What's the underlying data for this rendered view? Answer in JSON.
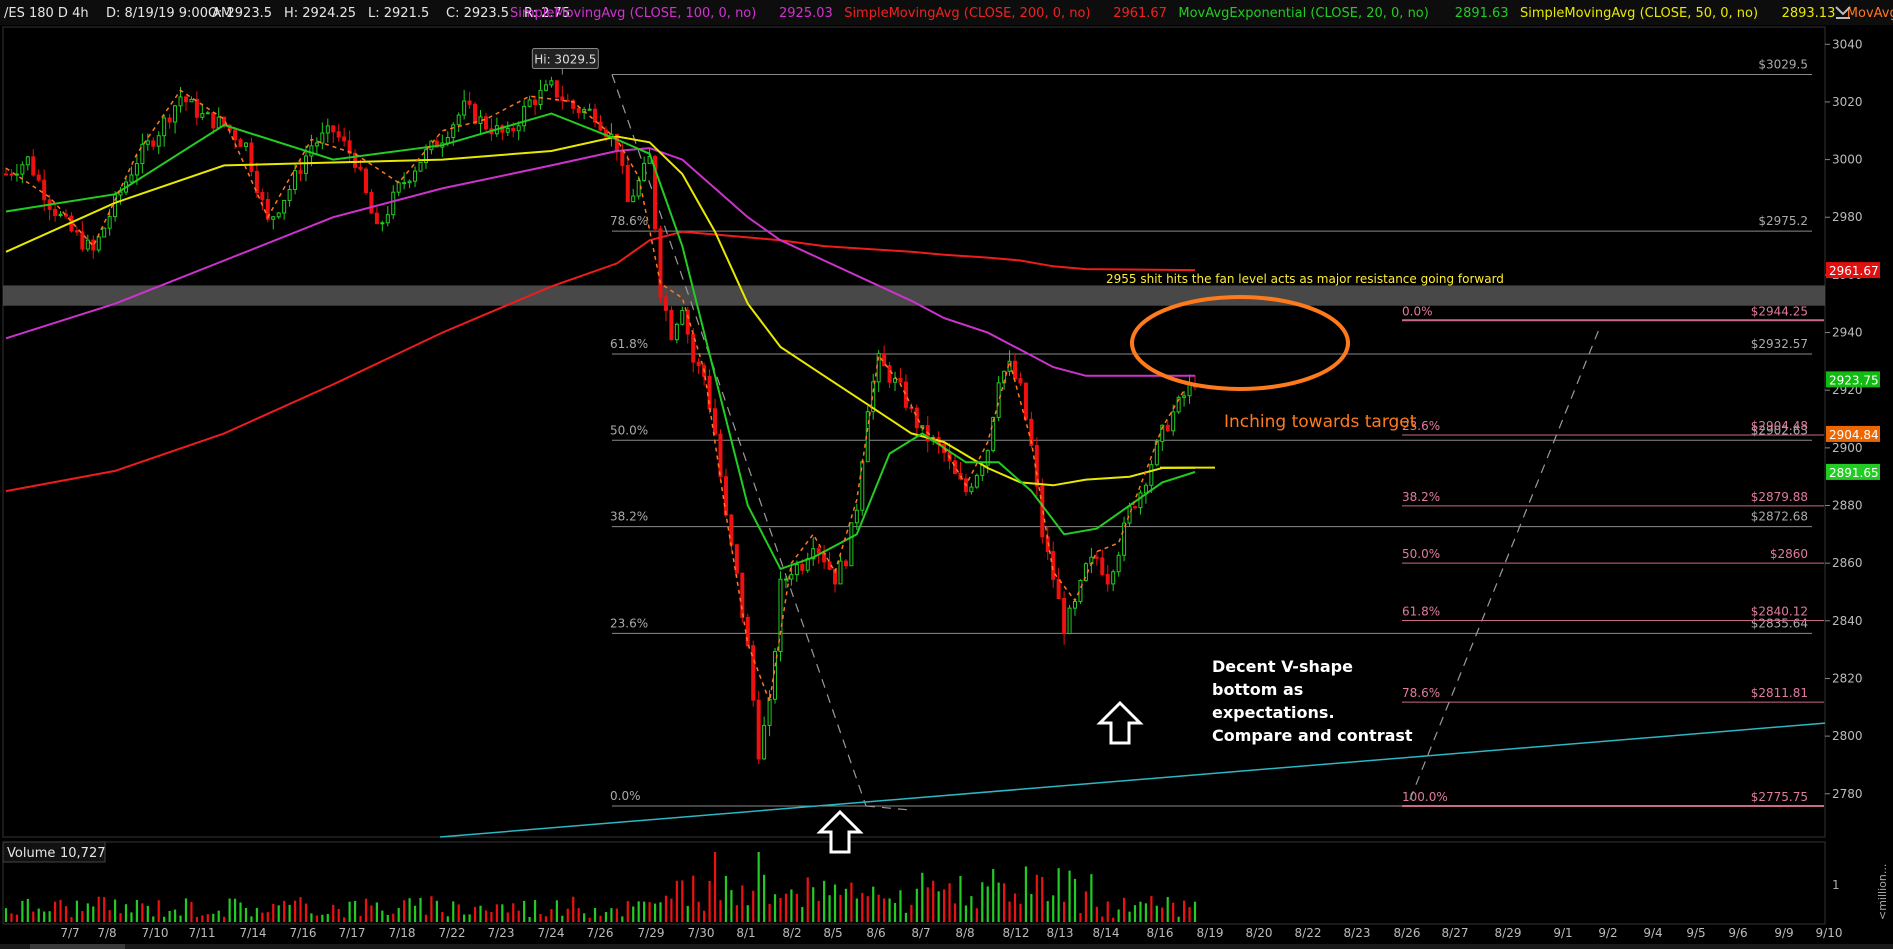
{
  "header": {
    "symbol": "/ES 180 D 4h",
    "date": "D: 8/19/19 9:00 AM",
    "open": "O: 2923.5",
    "high": "H: 2924.25",
    "low": "L: 2921.5",
    "close": "C: 2923.5",
    "range": "R: 2.75",
    "studies": [
      {
        "label": "SimpleMovingAvg (CLOSE, 100, 0, no)",
        "value": "2925.03",
        "color": "#d033d0"
      },
      {
        "label": "SimpleMovingAvg (CLOSE, 200, 0, no)",
        "value": "2961.67",
        "color": "#ee2222"
      },
      {
        "label": "MovAvgExponential (CLOSE, 20, 0, no)",
        "value": "2891.63",
        "color": "#22cc22"
      },
      {
        "label": "SimpleMovingAvg (CLOSE, 50, 0, no)",
        "value": "2893.13",
        "color": "#e8e800"
      },
      {
        "label": "MovAvgExponential (CLOSE,...",
        "value": "",
        "color": "#ff7722"
      }
    ]
  },
  "price_axis": {
    "ticks": [
      "3040",
      "3020",
      "3000",
      "2980",
      "2960",
      "2940",
      "2920",
      "2900",
      "2880",
      "2860",
      "2840",
      "2820",
      "2800",
      "2780"
    ],
    "badges": [
      {
        "text": "2961.67",
        "value": 2961.67,
        "bg": "#e01010"
      },
      {
        "text": "2923.75",
        "value": 2923.75,
        "bg": "#11bb11"
      },
      {
        "text": "2904.84",
        "value": 2904.84,
        "bg": "#ee6600"
      },
      {
        "text": "2891.65",
        "value": 2891.65,
        "bg": "#22cc22"
      }
    ]
  },
  "hi_label": "Hi: 3029.5",
  "fib_left": [
    {
      "pct": "78.6%",
      "value": 2975.2,
      "price": "$2975.2"
    },
    {
      "pct": "61.8%",
      "value": 2932.57,
      "price": "$2932.57"
    },
    {
      "pct": "50.0%",
      "value": 2902.63,
      "price": "$2902.63"
    },
    {
      "pct": "38.2%",
      "value": 2872.68,
      "price": "$2872.68"
    },
    {
      "pct": "23.6%",
      "value": 2835.64,
      "price": "$2835.64"
    },
    {
      "pct": "0.0%",
      "value": 2775.75,
      "price": ""
    }
  ],
  "fib_top_price": {
    "value": 3029.5,
    "price": "$3029.5"
  },
  "fib_right": [
    {
      "pct": "0.0%",
      "value": 2944.25,
      "price": "$2944.25"
    },
    {
      "pct": "23.6%",
      "value": 2904.48,
      "price": "$2904.48"
    },
    {
      "pct": "38.2%",
      "value": 2879.88,
      "price": "$2879.88"
    },
    {
      "pct": "50.0%",
      "value": 2860.0,
      "price": "$2860"
    },
    {
      "pct": "61.8%",
      "value": 2840.12,
      "price": "$2840.12"
    },
    {
      "pct": "78.6%",
      "value": 2811.81,
      "price": "$2811.81"
    },
    {
      "pct": "100.0%",
      "value": 2775.75,
      "price": "$2775.75"
    }
  ],
  "resistance_zone": [
    2950,
    2956
  ],
  "annotations": {
    "resistance_note": "2955 shit hits the fan level acts as  major resistance going forward",
    "target_note": "Inching towards target",
    "vshape_note": [
      "Decent V-shape",
      "bottom as",
      "expectations.",
      "Compare and contrast"
    ]
  },
  "volume": {
    "label": "Volume",
    "value": "10,727",
    "axis_tick": "1",
    "axis_unit": "<million..."
  },
  "x_axis": [
    "7/7",
    "7/8",
    "7/10",
    "7/11",
    "7/14",
    "7/16",
    "7/17",
    "7/18",
    "7/22",
    "7/23",
    "7/24",
    "7/26",
    "7/29",
    "7/30",
    "8/1",
    "8/2",
    "8/5",
    "8/6",
    "8/7",
    "8/8",
    "8/12",
    "8/13",
    "8/14",
    "8/16",
    "8/19",
    "8/20",
    "8/22",
    "8/23",
    "8/26",
    "8/27",
    "8/29",
    "9/1",
    "9/2",
    "9/4",
    "9/5",
    "9/6",
    "9/9",
    "9/10"
  ],
  "chart_data": {
    "type": "candlestick",
    "instrument": "/ES",
    "timeframe": "4h",
    "ylim": [
      2765,
      3046
    ],
    "price_path": [
      [
        0,
        2995
      ],
      [
        4,
        3000
      ],
      [
        8,
        2985
      ],
      [
        12,
        2975
      ],
      [
        16,
        2968
      ],
      [
        20,
        2985
      ],
      [
        24,
        3000
      ],
      [
        28,
        3010
      ],
      [
        32,
        3022
      ],
      [
        36,
        3015
      ],
      [
        40,
        3012
      ],
      [
        44,
        3005
      ],
      [
        48,
        2978
      ],
      [
        52,
        2990
      ],
      [
        56,
        3005
      ],
      [
        60,
        3010
      ],
      [
        64,
        3000
      ],
      [
        68,
        2975
      ],
      [
        72,
        2990
      ],
      [
        76,
        3000
      ],
      [
        80,
        3008
      ],
      [
        84,
        3018
      ],
      [
        88,
        3012
      ],
      [
        92,
        3008
      ],
      [
        96,
        3020
      ],
      [
        100,
        3025
      ],
      [
        104,
        3018
      ],
      [
        108,
        3016
      ],
      [
        112,
        3005
      ],
      [
        114,
        2985
      ],
      [
        116,
        2992
      ],
      [
        118,
        3000
      ],
      [
        120,
        2955
      ],
      [
        122,
        2940
      ],
      [
        124,
        2950
      ],
      [
        126,
        2930
      ],
      [
        128,
        2925
      ],
      [
        130,
        2905
      ],
      [
        132,
        2875
      ],
      [
        134,
        2855
      ],
      [
        136,
        2830
      ],
      [
        138,
        2795
      ],
      [
        140,
        2810
      ],
      [
        142,
        2852
      ],
      [
        144,
        2858
      ],
      [
        146,
        2860
      ],
      [
        148,
        2868
      ],
      [
        150,
        2862
      ],
      [
        152,
        2855
      ],
      [
        154,
        2862
      ],
      [
        156,
        2880
      ],
      [
        158,
        2915
      ],
      [
        160,
        2930
      ],
      [
        162,
        2925
      ],
      [
        164,
        2920
      ],
      [
        166,
        2912
      ],
      [
        168,
        2905
      ],
      [
        170,
        2902
      ],
      [
        172,
        2898
      ],
      [
        174,
        2890
      ],
      [
        176,
        2885
      ],
      [
        178,
        2892
      ],
      [
        180,
        2900
      ],
      [
        182,
        2925
      ],
      [
        184,
        2928
      ],
      [
        186,
        2920
      ],
      [
        188,
        2900
      ],
      [
        190,
        2870
      ],
      [
        192,
        2855
      ],
      [
        194,
        2838
      ],
      [
        196,
        2845
      ],
      [
        198,
        2858
      ],
      [
        200,
        2862
      ],
      [
        202,
        2855
      ],
      [
        204,
        2865
      ],
      [
        206,
        2878
      ],
      [
        208,
        2885
      ],
      [
        210,
        2895
      ],
      [
        212,
        2905
      ],
      [
        214,
        2912
      ],
      [
        216,
        2918
      ],
      [
        218,
        2923.5
      ]
    ],
    "ma_ema20": [
      [
        0,
        2982
      ],
      [
        20,
        2988
      ],
      [
        40,
        3012
      ],
      [
        60,
        3000
      ],
      [
        80,
        3005
      ],
      [
        100,
        3016
      ],
      [
        112,
        3007
      ],
      [
        118,
        3002
      ],
      [
        124,
        2970
      ],
      [
        130,
        2925
      ],
      [
        136,
        2880
      ],
      [
        142,
        2858
      ],
      [
        148,
        2862
      ],
      [
        156,
        2870
      ],
      [
        162,
        2898
      ],
      [
        168,
        2905
      ],
      [
        176,
        2895
      ],
      [
        182,
        2895
      ],
      [
        188,
        2885
      ],
      [
        194,
        2870
      ],
      [
        200,
        2872
      ],
      [
        206,
        2880
      ],
      [
        212,
        2888
      ],
      [
        218,
        2891.63
      ]
    ],
    "ma_sma50": [
      [
        0,
        2968
      ],
      [
        20,
        2985
      ],
      [
        40,
        2998
      ],
      [
        60,
        2999
      ],
      [
        80,
        3000
      ],
      [
        100,
        3003
      ],
      [
        112,
        3008
      ],
      [
        118,
        3006
      ],
      [
        124,
        2995
      ],
      [
        130,
        2975
      ],
      [
        136,
        2950
      ],
      [
        142,
        2935
      ],
      [
        150,
        2925
      ],
      [
        158,
        2915
      ],
      [
        166,
        2905
      ],
      [
        172,
        2902
      ],
      [
        180,
        2893
      ],
      [
        186,
        2888
      ],
      [
        192,
        2887
      ],
      [
        198,
        2889
      ],
      [
        206,
        2890
      ],
      [
        212,
        2893
      ],
      [
        218,
        2893.13
      ]
    ],
    "ma_sma100": [
      [
        0,
        2938
      ],
      [
        20,
        2950
      ],
      [
        40,
        2965
      ],
      [
        60,
        2980
      ],
      [
        80,
        2990
      ],
      [
        100,
        2998
      ],
      [
        112,
        3003
      ],
      [
        118,
        3004
      ],
      [
        124,
        3000
      ],
      [
        130,
        2990
      ],
      [
        136,
        2980
      ],
      [
        142,
        2972
      ],
      [
        150,
        2965
      ],
      [
        158,
        2958
      ],
      [
        166,
        2951
      ],
      [
        172,
        2945
      ],
      [
        180,
        2940
      ],
      [
        186,
        2934
      ],
      [
        192,
        2928
      ],
      [
        198,
        2925
      ],
      [
        218,
        2925.03
      ]
    ],
    "ma_sma200": [
      [
        0,
        2885
      ],
      [
        20,
        2892
      ],
      [
        40,
        2905
      ],
      [
        60,
        2922
      ],
      [
        80,
        2940
      ],
      [
        100,
        2956
      ],
      [
        112,
        2964
      ],
      [
        118,
        2972
      ],
      [
        124,
        2975
      ],
      [
        130,
        2974
      ],
      [
        136,
        2973
      ],
      [
        142,
        2972
      ],
      [
        150,
        2970
      ],
      [
        158,
        2969
      ],
      [
        166,
        2968
      ],
      [
        172,
        2967
      ],
      [
        180,
        2966
      ],
      [
        186,
        2965
      ],
      [
        192,
        2963
      ],
      [
        198,
        2962
      ],
      [
        218,
        2961.67
      ]
    ],
    "high": 3029.5,
    "low": 2775.75,
    "last": 2923.75
  }
}
